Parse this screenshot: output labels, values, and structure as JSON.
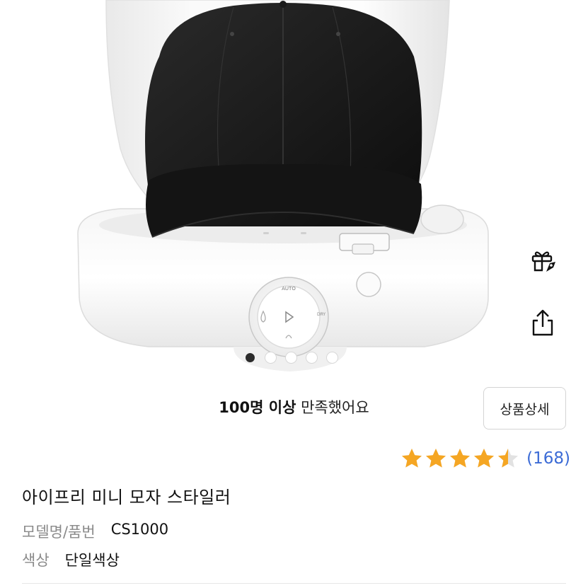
{
  "product_image": {
    "icon": "hat-styler-product-photo",
    "device_labels": {
      "auto": "AUTO",
      "dry": "DRY"
    }
  },
  "carousel": {
    "total": 5,
    "active_index": 0
  },
  "actions": {
    "gift_icon": "gift-icon",
    "share_icon": "share-icon"
  },
  "satisfaction": {
    "count": "100명 이상",
    "rest": " 만족했어요"
  },
  "detail_button": {
    "label": "상품상세"
  },
  "rating": {
    "value": 4.5,
    "max": 5,
    "review_count": "(168)",
    "star_color": "#f5a623"
  },
  "product": {
    "title": "아이프리 미니 모자 스타일러",
    "model_label": "모델명/품번",
    "model_value": "CS1000",
    "color_label": "색상",
    "color_value": "단일색상"
  }
}
